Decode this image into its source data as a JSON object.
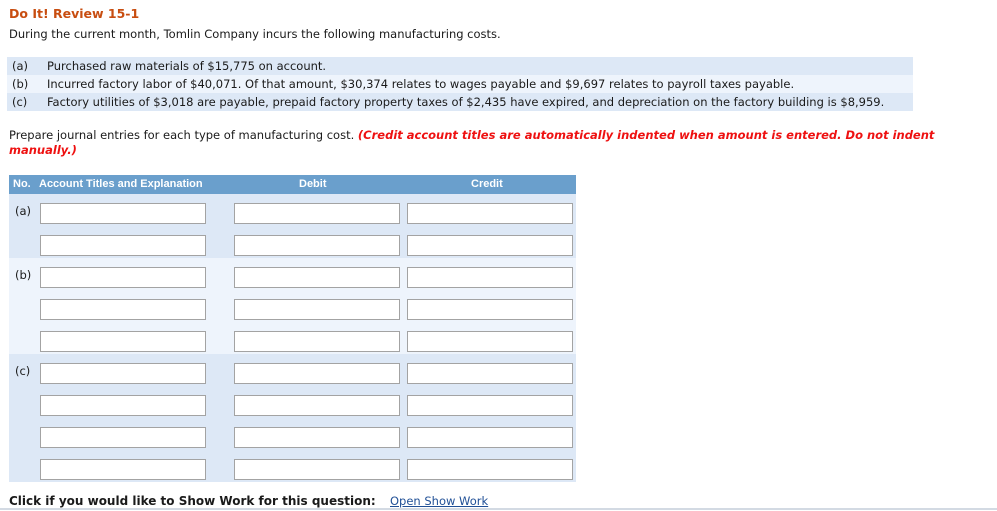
{
  "title": "Do It! Review 15-1",
  "intro": "During the current month, Tomlin Company incurs the following manufacturing costs.",
  "problems": [
    {
      "label": "(a)",
      "text": "Purchased raw materials of $15,775 on account."
    },
    {
      "label": "(b)",
      "text": "Incurred factory labor of $40,071. Of that amount, $30,374 relates to wages payable and $9,697 relates to payroll taxes payable."
    },
    {
      "label": "(c)",
      "text": "Factory utilities of $3,018 are payable, prepaid factory property taxes of $2,435 have expired, and depreciation on the factory building is $8,959."
    }
  ],
  "instructions": {
    "text": "Prepare journal entries for each type of manufacturing cost. ",
    "note": "(Credit account titles are automatically indented when amount is entered. Do not indent manually.)"
  },
  "journal": {
    "headers": {
      "no": "No.",
      "account": "Account Titles and Explanation",
      "debit": "Debit",
      "credit": "Credit"
    },
    "groups": [
      {
        "label": "(a)",
        "rows": [
          {
            "account": "",
            "debit": "",
            "credit": ""
          },
          {
            "account": "",
            "debit": "",
            "credit": ""
          }
        ]
      },
      {
        "label": "(b)",
        "rows": [
          {
            "account": "",
            "debit": "",
            "credit": ""
          },
          {
            "account": "",
            "debit": "",
            "credit": ""
          },
          {
            "account": "",
            "debit": "",
            "credit": ""
          }
        ]
      },
      {
        "label": "(c)",
        "rows": [
          {
            "account": "",
            "debit": "",
            "credit": ""
          },
          {
            "account": "",
            "debit": "",
            "credit": ""
          },
          {
            "account": "",
            "debit": "",
            "credit": ""
          },
          {
            "account": "",
            "debit": "",
            "credit": ""
          }
        ]
      }
    ]
  },
  "footer": {
    "prompt": "Click if you would like to Show Work for this question:",
    "link": "Open Show Work"
  }
}
